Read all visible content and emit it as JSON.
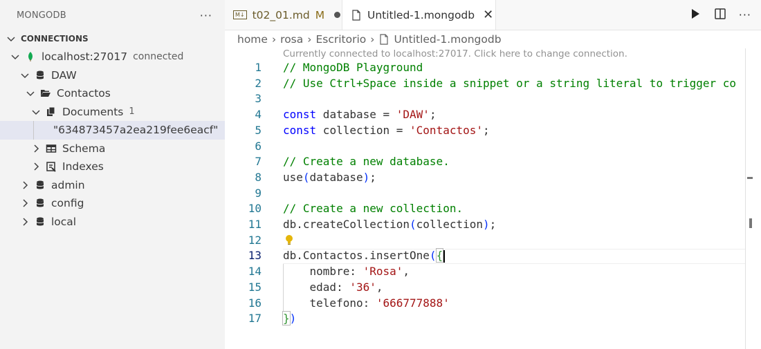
{
  "sidebar": {
    "title": "MONGODB",
    "more": "···",
    "section": "CONNECTIONS",
    "items": [
      {
        "label": "localhost:27017",
        "status": "connected"
      },
      {
        "label": "DAW"
      },
      {
        "label": "Contactos"
      },
      {
        "label": "Documents",
        "count": "1"
      },
      {
        "label": "\"634873457a2ea219fee6eacf\""
      },
      {
        "label": "Schema"
      },
      {
        "label": "Indexes"
      },
      {
        "label": "admin"
      },
      {
        "label": "config"
      },
      {
        "label": "local"
      }
    ]
  },
  "tabs": [
    {
      "label": "t02_01.md",
      "flag": "M",
      "icon": "M↓"
    },
    {
      "label": "Untitled-1.mongodb"
    }
  ],
  "breadcrumb": [
    "home",
    "rosa",
    "Escritorio",
    "Untitled-1.mongodb"
  ],
  "codelens": "Currently connected to localhost:27017. Click here to change connection.",
  "editor": {
    "line_numbers": [
      "1",
      "2",
      "3",
      "4",
      "5",
      "6",
      "7",
      "8",
      "9",
      "10",
      "11",
      "12",
      "13",
      "14",
      "15",
      "16",
      "17"
    ],
    "code": {
      "l1": "// MongoDB Playground",
      "l2": "// Use Ctrl+Space inside a snippet or a string literal to trigger co",
      "l4_kw": "const",
      "l4_a": " database = ",
      "l4_s": "'DAW'",
      "l4_b": ";",
      "l5_kw": "const",
      "l5_a": " collection = ",
      "l5_s": "'Contactos'",
      "l5_b": ";",
      "l7": "// Create a new database.",
      "l8_a": "use",
      "l8_p1": "(",
      "l8_b": "database",
      "l8_p2": ")",
      "l8_c": ";",
      "l10": "// Create a new collection.",
      "l11_a": "db.createCollection",
      "l11_p1": "(",
      "l11_b": "collection",
      "l11_p2": ")",
      "l11_c": ";",
      "l13_a": "db.Contactos.insertOne",
      "l13_p": "(",
      "l13_b": "{",
      "l14_a": "    nombre: ",
      "l14_s": "'Rosa'",
      "l14_b": ",",
      "l15_a": "    edad: ",
      "l15_s": "'36'",
      "l15_b": ",",
      "l16_a": "    telefono: ",
      "l16_s": "'666777888'",
      "l17_a": "}",
      "l17_b": ")"
    }
  },
  "colors": {
    "comment": "#008000",
    "keyword": "#0000ff",
    "string": "#a31515",
    "line_number": "#237893",
    "mongo_leaf": "#13aa52"
  }
}
